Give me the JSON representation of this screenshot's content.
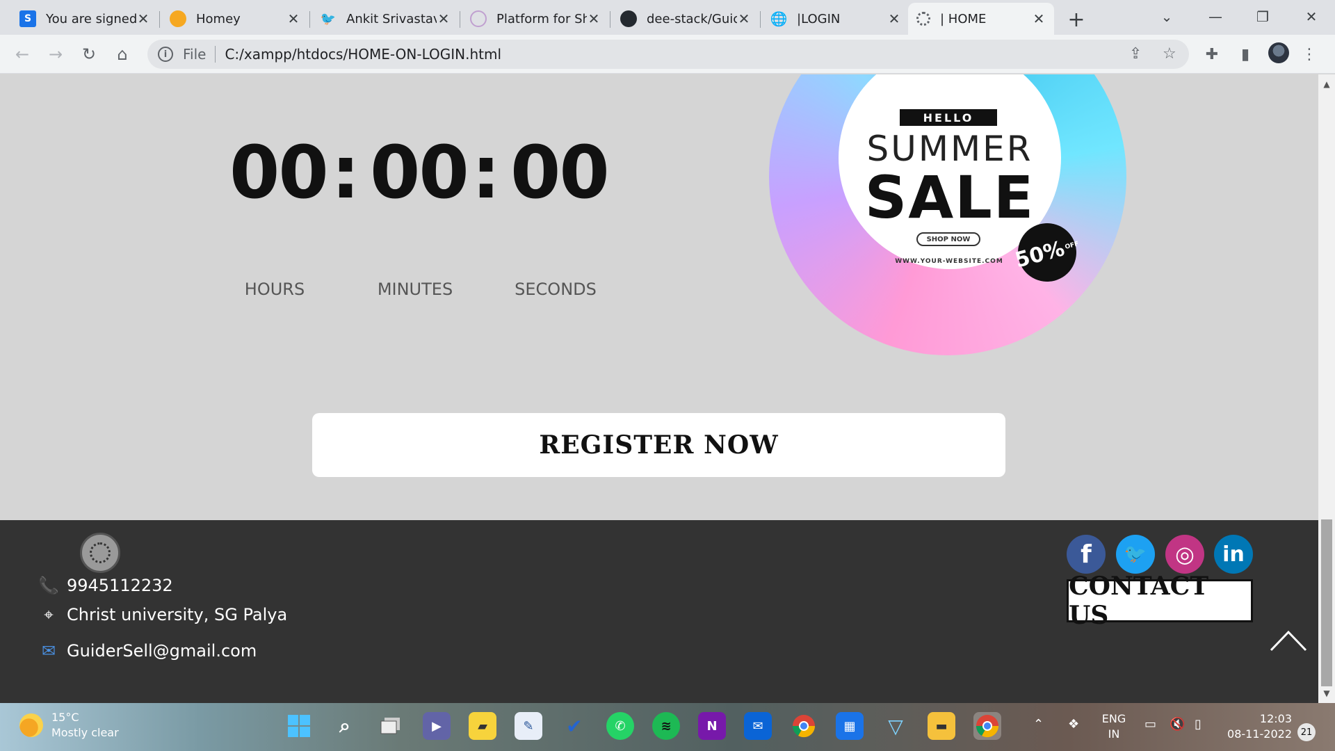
{
  "browser": {
    "tabs": [
      {
        "label": "You are signed",
        "icon": "s-icon",
        "icon_text": "S",
        "color": "#1a73e8"
      },
      {
        "label": "Homey",
        "icon": "homey-icon",
        "icon_text": "",
        "color": "#f6a821"
      },
      {
        "label": "Ankit Srivastav",
        "icon": "twitter-icon",
        "icon_text": "",
        "color": "#1d9bf0"
      },
      {
        "label": "Platform for Sh",
        "icon": "platform-icon",
        "icon_text": "",
        "color": "#c0a0d0"
      },
      {
        "label": "dee-stack/Guic",
        "icon": "github-icon",
        "icon_text": "",
        "color": "#24292f"
      },
      {
        "label": "|LOGIN",
        "icon": "globe-icon",
        "icon_text": "",
        "color": "#5f6368"
      },
      {
        "label": "| HOME",
        "icon": "site-logo-icon",
        "icon_text": "",
        "color": "#5f6368"
      }
    ],
    "address": {
      "scheme": "File",
      "url": "C:/xampp/htdocs/HOME-ON-LOGIN.html"
    }
  },
  "countdown": {
    "hours": "00",
    "minutes": "00",
    "seconds": "00",
    "separator": ":",
    "labels": {
      "hours": "HOURS",
      "minutes": "MINUTES",
      "seconds": "SECONDS"
    }
  },
  "promo": {
    "hello": "HELLO",
    "summer": "SUMMER",
    "sale": "SALE",
    "shop_now": "SHOP NOW",
    "website": "WWW.YOUR-WEBSITE.COM",
    "discount": "50%",
    "discount_suffix": "OFF"
  },
  "register_button": "REGISTER NOW",
  "footer": {
    "phone": "9945112232",
    "address": "Christ university, SG Palya",
    "email": "GuiderSell@gmail.com",
    "contact_button": "CONTACT US",
    "social": [
      {
        "name": "facebook",
        "glyph": "f",
        "color": "#3b5998"
      },
      {
        "name": "twitter",
        "glyph": "🐦",
        "color": "#1da1f2"
      },
      {
        "name": "instagram",
        "glyph": "◎",
        "color": "#c13584"
      },
      {
        "name": "linkedin",
        "glyph": "in",
        "color": "#0077b5"
      }
    ]
  },
  "taskbar": {
    "temperature": "15°C",
    "weather": "Mostly clear",
    "language_top": "ENG",
    "language_bottom": "IN",
    "time": "12:03",
    "date": "08-11-2022",
    "notifications": "21"
  }
}
